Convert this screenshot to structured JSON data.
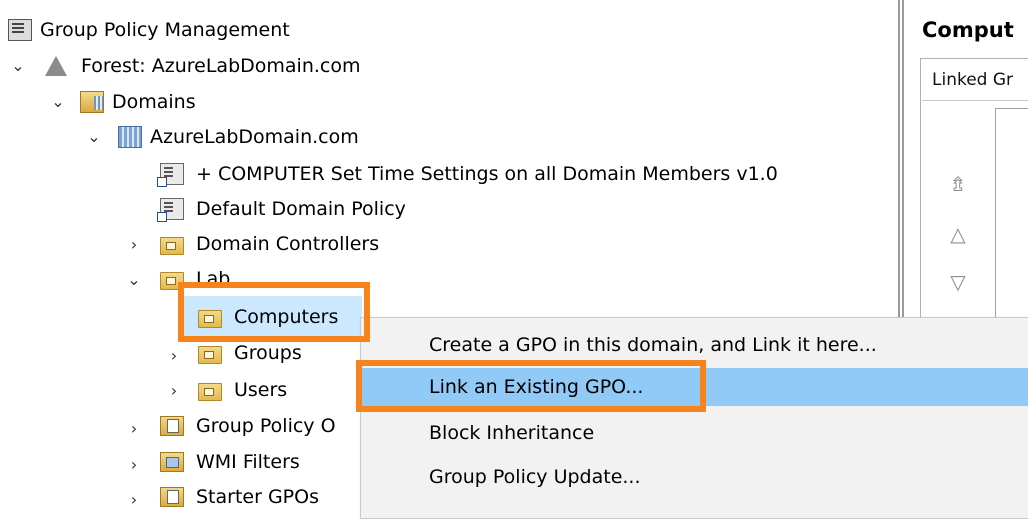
{
  "tree": {
    "root": "Group Policy Management",
    "forest": "Forest: AzureLabDomain.com",
    "domains": "Domains",
    "domain": "AzureLabDomain.com",
    "gpo_link_1": "+ COMPUTER Set Time Settings on all Domain Members v1.0",
    "gpo_link_2": "Default Domain Policy",
    "ou_domain_controllers": "Domain Controllers",
    "ou_lab": "Lab",
    "ou_computers": "Computers",
    "ou_groups": "Groups",
    "ou_users": "Users",
    "gpo_objects": "Group Policy O",
    "wmi_filters": "WMI Filters",
    "starter_gpos": "Starter GPOs"
  },
  "right_panel": {
    "title": "Comput",
    "tab": "Linked Gr"
  },
  "context_menu": {
    "items": [
      "Create a GPO in this domain, and Link it here...",
      "Link an Existing GPO...",
      "Block Inheritance",
      "Group Policy Update..."
    ]
  },
  "colors": {
    "annotation": "#f7831d",
    "highlight": "#91c9f7",
    "selection": "#cce8ff"
  }
}
